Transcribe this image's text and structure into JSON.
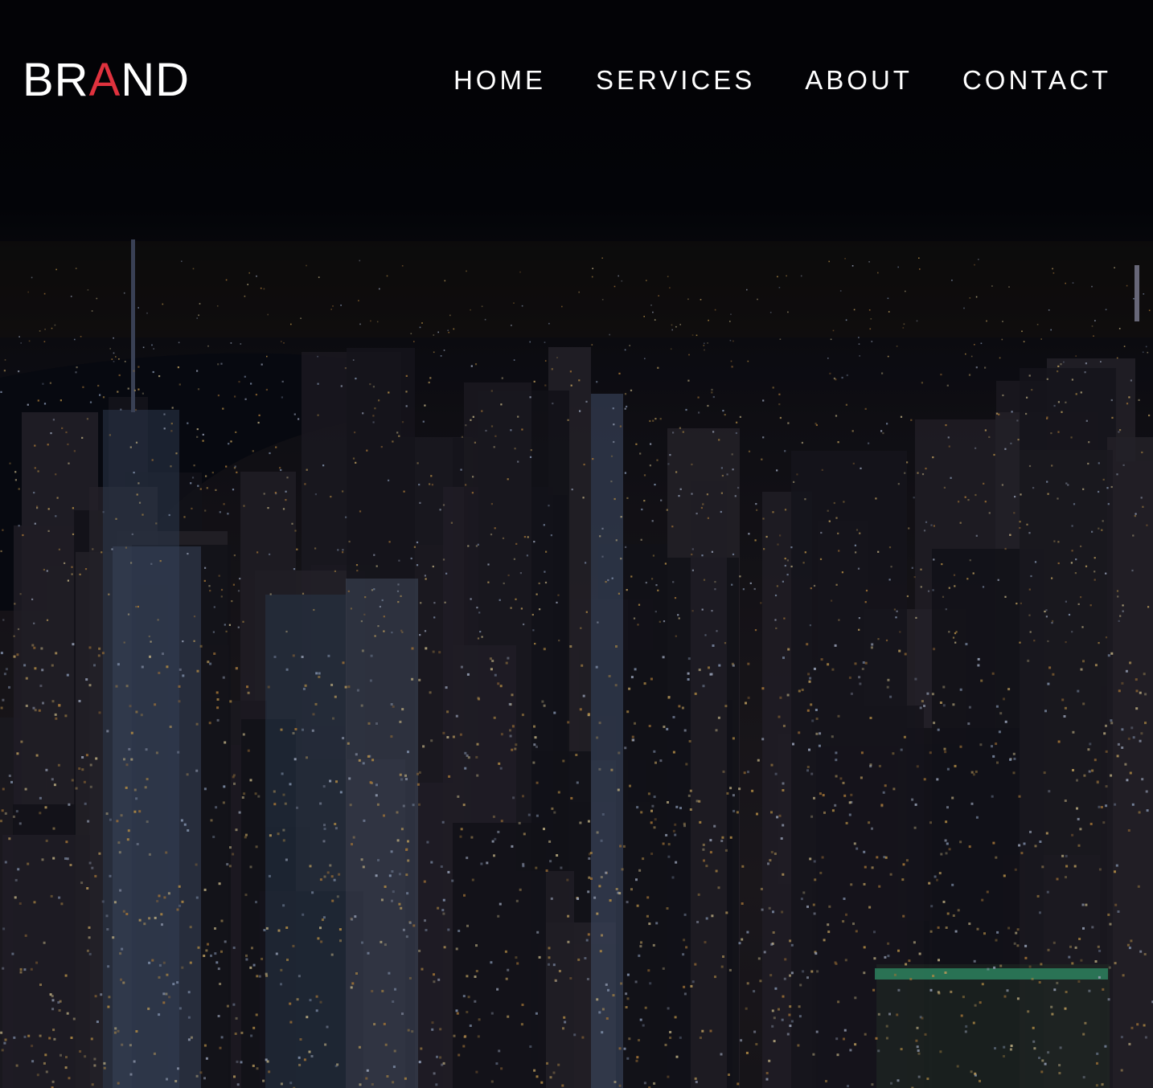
{
  "colors": {
    "brand_accent": "#e0323e",
    "nav_text": "#ffffff",
    "background": "#05060a"
  },
  "brand": {
    "part1": "BR",
    "accent": "A",
    "part2": "ND"
  },
  "nav": {
    "items": [
      {
        "label": "HOME"
      },
      {
        "label": "SERVICES"
      },
      {
        "label": "ABOUT"
      },
      {
        "label": "CONTACT"
      }
    ]
  }
}
